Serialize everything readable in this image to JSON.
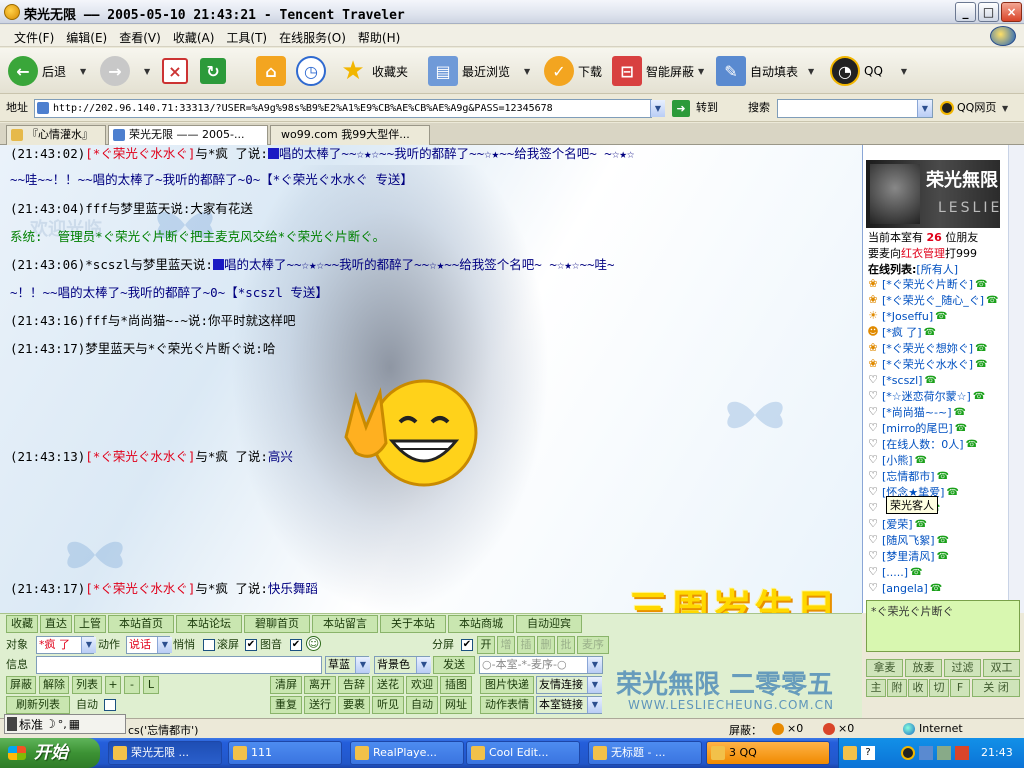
{
  "window": {
    "title": "荣光无限 —— 2005-05-10 21:43:21 - Tencent Traveler",
    "min": "_",
    "max": "□",
    "close": "×"
  },
  "menu": [
    "文件(F)",
    "编辑(E)",
    "查看(V)",
    "收藏(A)",
    "工具(T)",
    "在线服务(O)",
    "帮助(H)"
  ],
  "toolbar": {
    "back": "后退",
    "favorites": "收藏夹",
    "recent": "最近浏览",
    "download": "下载",
    "smart_block": "智能屏蔽",
    "autofill": "自动填表",
    "qq": "QQ"
  },
  "address": {
    "label": "地址",
    "url": "http://202.96.140.71:33313/?USER=%A9g%98s%B9%E2%A1%E9%CB%AE%CB%AE%A9g&PASS=12345678",
    "go": "转到",
    "search_label": "搜索",
    "search_value": "",
    "qq_web": "QQ网页"
  },
  "tabs": [
    "『心情灌水』",
    "荣光无限 —— 2005-...",
    "wo99.com 我99大型伴..."
  ],
  "chat": {
    "messages": [
      {
        "t": "(21:43:02)",
        "from": "[*ぐ荣光ぐ水水ぐ]",
        "rest": "与*疯 了说:",
        "text": "唱的太棒了~~☆★☆~~我听的都醉了~~☆★~~给我签个名吧~ ~☆★☆"
      },
      {
        "cont": "~~哇~~！！~~唱的太棒了~我听的都醉了~0~",
        "tag": "【*ぐ荣光ぐ水水ぐ 专送】"
      },
      {
        "t": "(21:43:04)",
        "line": "fff与梦里蓝天说:大家有花送"
      },
      {
        "sys_label": "系统:",
        "sys_text": "管理员*ぐ荣光ぐ片断ぐ把主麦克风交给*ぐ荣光ぐ片断ぐ。"
      },
      {
        "t": "(21:43:06)",
        "from": "*scszl",
        "rest": "与梦里蓝天说:",
        "text": "唱的太棒了~~☆★☆~~我听的都醉了~~☆★~~给我签个名吧~ ~☆★☆~~哇~"
      },
      {
        "cont": "~！！~~唱的太棒了~我听的都醉了~0~",
        "tag": "【*scszl 专送】"
      },
      {
        "t": "(21:43:16)",
        "line": "fff与*尚尚猫~-~说:你平时就这样吧"
      },
      {
        "t": "(21:43:17)",
        "line": "梦里蓝天与*ぐ荣光ぐ片断ぐ说:哈"
      },
      {
        "t": "(21:43:13)",
        "from": "[*ぐ荣光ぐ水水ぐ]",
        "rest": "与*疯 了说:",
        "text": "高兴"
      },
      {
        "t": "(21:43:17)",
        "from": "[*ぐ荣光ぐ水水ぐ]",
        "rest": "与*疯 了说:",
        "text": "快乐舞蹈"
      }
    ],
    "watermark": "欢迎光临",
    "anniversary": "三周岁生日快乐",
    "brand_cn": "荣光無限 二零零五",
    "brand_url": "WWW.LESLIECHEUNG.COM.CN"
  },
  "sidebar": {
    "logo_text": "荣光無限",
    "logo_sub": "LESLIE",
    "count_pre": "当前本室有",
    "count": "26",
    "count_post": "位朋友",
    "request_pre": "要麦向",
    "request_admin": "红衣管理",
    "request_post": "打999",
    "online_label": "在线列表:",
    "online_filter": "[所有人]",
    "users": [
      {
        "icon": "❀",
        "name": "[*ぐ荣光ぐ片断ぐ]"
      },
      {
        "icon": "❀",
        "name": "[*ぐ荣光ぐ_随心_ぐ]"
      },
      {
        "icon": "☀",
        "name": "[*Joseffu]"
      },
      {
        "icon": "☻",
        "name": "[*疯 了]"
      },
      {
        "icon": "❀",
        "name": "[*ぐ荣光ぐ想妳ぐ]"
      },
      {
        "icon": "❀",
        "name": "[*ぐ荣光ぐ水水ぐ]"
      },
      {
        "icon": "♡",
        "name": "[*scszl]"
      },
      {
        "icon": "♡",
        "name": "[*☆迷恋荷尔蒙☆]"
      },
      {
        "icon": "♡",
        "name": "[*尚尚猫~-~]"
      },
      {
        "icon": "♡",
        "name": "[mirro的尾巴]"
      },
      {
        "icon": "♡",
        "name": "[在线人数：0人]"
      },
      {
        "icon": "♡",
        "name": "[小熊]"
      },
      {
        "icon": "♡",
        "name": "[忘情都市]"
      },
      {
        "icon": "♡",
        "name": "[怀念★挚爱]"
      },
      {
        "icon": "♡",
        "name": "荣光客人"
      },
      {
        "icon": "♡",
        "name": "[爱荣]"
      },
      {
        "icon": "♡",
        "name": "[随风飞絮]"
      },
      {
        "icon": "♡",
        "name": "[梦里清风]"
      },
      {
        "icon": "♡",
        "name": "[.....]"
      },
      {
        "icon": "♡",
        "name": "[angela]"
      }
    ],
    "selected_user": "*ぐ荣光ぐ片断ぐ",
    "buttons_row1": [
      "拿麦",
      "放麦",
      "过滤",
      "双工"
    ],
    "buttons_row2": [
      "主",
      "附",
      "收",
      "切",
      "F",
      "关 闭"
    ]
  },
  "controls": {
    "row1": [
      "收藏",
      "直达",
      "上管",
      "本站首页",
      "本站论坛",
      "碧聊首页",
      "本站留言",
      "关于本站",
      "本站商城",
      "自动迎宾"
    ],
    "target_label": "对象",
    "target_value": "*疯 了",
    "action_label": "动作",
    "action_value": "说话",
    "whisper_label": "悄悄",
    "scroll_label": "滚屏",
    "image_label": "图音",
    "split_label": "分屏",
    "mini_buttons": [
      "开",
      "增",
      "插",
      "删",
      "批",
      "麦序"
    ],
    "info_label": "信息",
    "info_value": "",
    "font_color": "草蓝",
    "bg_color": "背景色",
    "send": "发送",
    "room_filter": "○-本室-*-麦序-○",
    "left_buttons": [
      "屏蔽",
      "解除",
      "列表",
      "+",
      "-",
      "L"
    ],
    "refresh": "刷新列表",
    "auto_label": "自动",
    "grid_row1": [
      "清屏",
      "离开",
      "告辞",
      "送花",
      "欢迎",
      "插图"
    ],
    "grid_row2": [
      "重复",
      "送行",
      "要裹",
      "听见",
      "自动",
      "网址"
    ],
    "quick_reply": "图片快递",
    "friend_link": "友情连接",
    "action_emote": "动作表情",
    "room_link": "本室链接"
  },
  "ime": {
    "label": "标准"
  },
  "status": {
    "text": "cs('忘情都市')",
    "block": "屏蔽：",
    "x1": "×0",
    "x2": "×0",
    "zone": "Internet"
  },
  "taskbar": {
    "start": "开始",
    "tasks": [
      "荣光无限 ...",
      "111",
      "RealPlaye...",
      "Cool Edit...",
      "无标题 - ...",
      "3 QQ"
    ],
    "time": "21:43"
  }
}
